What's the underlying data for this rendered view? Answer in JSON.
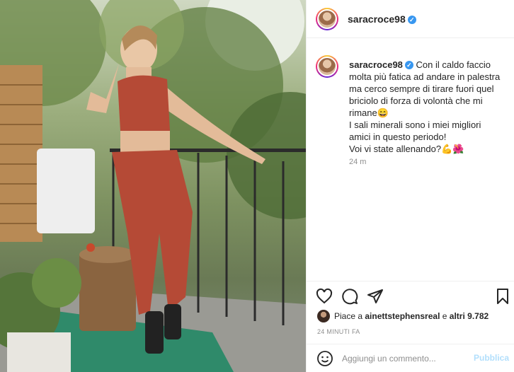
{
  "post": {
    "username": "saracroce98",
    "verified_icon": "verified-badge-icon",
    "caption_lines": [
      "Con il caldo faccio",
      "molta più fatica ad andare in palestra",
      "ma cerco sempre di tirare fuori quel",
      "briciolo di forza di volontà che mi",
      "rimane😄",
      "I sali minerali sono i miei migliori",
      "amici in questo periodo!",
      "Voi vi state allenando?💪🌺"
    ],
    "caption_time": "24 m",
    "likes_prefix": "Piace a ",
    "likes_user": "ainettstephensreal",
    "likes_middle": " e ",
    "likes_others": "altri 9.782",
    "time_ago": "24 MINUTI FA",
    "comment_placeholder": "Aggiungi un commento...",
    "post_button": "Pubblica"
  },
  "icons": {
    "like": "heart-icon",
    "comment": "comment-icon",
    "share": "paper-plane-icon",
    "save": "bookmark-icon",
    "emoji": "emoji-icon"
  },
  "colors": {
    "link_blue": "#3897f0",
    "post_button_disabled": "#b2dffc",
    "muted": "#8e8e8e"
  }
}
